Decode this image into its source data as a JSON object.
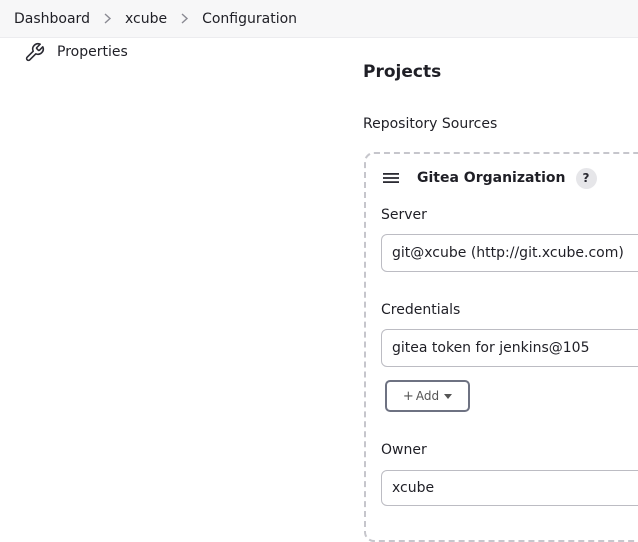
{
  "breadcrumb": {
    "items": [
      "Dashboard",
      "xcube",
      "Configuration"
    ]
  },
  "sidebar": {
    "item_label": "Properties",
    "item_icon": "wrench-icon"
  },
  "main": {
    "section_title": "Projects",
    "repository_sources_label": "Repository Sources",
    "source": {
      "title": "Gitea Organization",
      "help_label": "?",
      "server_label": "Server",
      "server_value": "git@xcube (http://git.xcube.com)",
      "credentials_label": "Credentials",
      "credentials_value": "gitea token for jenkins@105",
      "add_label": "Add",
      "add_prefix": "+",
      "owner_label": "Owner",
      "owner_value": "xcube"
    }
  },
  "colors": {
    "breadcrumb_bg": "#f7f7f8",
    "panel_border": "#c6c6cc",
    "input_border": "#bcbcc3",
    "add_button_border": "#6e7282"
  }
}
